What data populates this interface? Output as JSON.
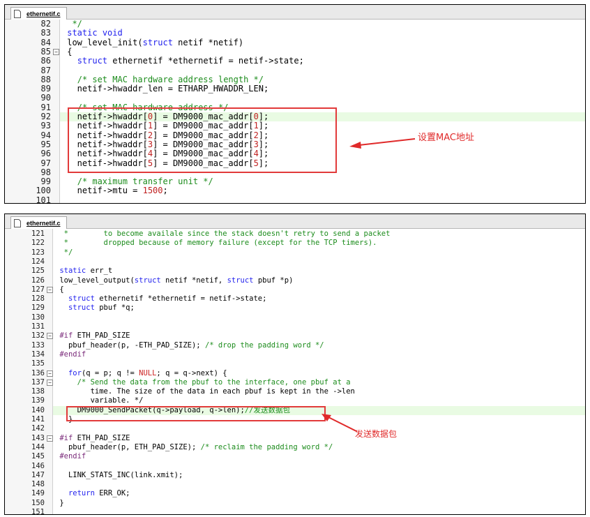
{
  "colors": {
    "keyword": "#2222ee",
    "comment": "#1c8c1c",
    "number": "#c02020",
    "annotation": "#e02a2a",
    "highlight": "#e9fbe3"
  },
  "panel1": {
    "tab": {
      "label": "ethernetif.c",
      "icon": "file-icon"
    },
    "lines": [
      {
        "n": "82",
        "text": "  */"
      },
      {
        "n": "83",
        "text": " static void"
      },
      {
        "n": "84",
        "text": " low_level_init(struct netif *netif)"
      },
      {
        "n": "85",
        "text": " {"
      },
      {
        "n": "86",
        "text": "   struct ethernetif *ethernetif = netif->state;"
      },
      {
        "n": "87",
        "text": ""
      },
      {
        "n": "88",
        "text": "   /* set MAC hardware address length */"
      },
      {
        "n": "89",
        "text": "   netif->hwaddr_len = ETHARP_HWADDR_LEN;"
      },
      {
        "n": "90",
        "text": ""
      },
      {
        "n": "91",
        "text": "   /* set MAC hardware address */"
      },
      {
        "n": "92",
        "text": "   netif->hwaddr[0] = DM9000_mac_addr[0];"
      },
      {
        "n": "93",
        "text": "   netif->hwaddr[1] = DM9000_mac_addr[1];"
      },
      {
        "n": "94",
        "text": "   netif->hwaddr[2] = DM9000_mac_addr[2];"
      },
      {
        "n": "95",
        "text": "   netif->hwaddr[3] = DM9000_mac_addr[3];"
      },
      {
        "n": "96",
        "text": "   netif->hwaddr[4] = DM9000_mac_addr[4];"
      },
      {
        "n": "97",
        "text": "   netif->hwaddr[5] = DM9000_mac_addr[5];"
      },
      {
        "n": "98",
        "text": ""
      },
      {
        "n": "99",
        "text": "   /* maximum transfer unit */"
      },
      {
        "n": "100",
        "text": "   netif->mtu = 1500;"
      },
      {
        "n": "101",
        "text": ""
      }
    ],
    "annotation": "设置MAC地址"
  },
  "panel2": {
    "tab": {
      "label": "ethernetif.c",
      "icon": "file-icon"
    },
    "lines": [
      {
        "n": "121",
        "text": "  *        to become availale since the stack doesn't retry to send a packet"
      },
      {
        "n": "122",
        "text": "  *        dropped because of memory failure (except for the TCP timers)."
      },
      {
        "n": "123",
        "text": "  */"
      },
      {
        "n": "124",
        "text": ""
      },
      {
        "n": "125",
        "text": " static err_t"
      },
      {
        "n": "126",
        "text": " low_level_output(struct netif *netif, struct pbuf *p)"
      },
      {
        "n": "127",
        "text": " {"
      },
      {
        "n": "128",
        "text": "   struct ethernetif *ethernetif = netif->state;"
      },
      {
        "n": "129",
        "text": "   struct pbuf *q;"
      },
      {
        "n": "130",
        "text": ""
      },
      {
        "n": "131",
        "text": ""
      },
      {
        "n": "132",
        "text": " #if ETH_PAD_SIZE"
      },
      {
        "n": "133",
        "text": "   pbuf_header(p, -ETH_PAD_SIZE); /* drop the padding word */"
      },
      {
        "n": "134",
        "text": " #endif"
      },
      {
        "n": "135",
        "text": ""
      },
      {
        "n": "136",
        "text": "   for(q = p; q != NULL; q = q->next) {"
      },
      {
        "n": "137",
        "text": "     /* Send the data from the pbuf to the interface, one pbuf at a"
      },
      {
        "n": "138",
        "text": "        time. The size of the data in each pbuf is kept in the ->len"
      },
      {
        "n": "139",
        "text": "        variable. */"
      },
      {
        "n": "140",
        "text": "     DM9000_SendPacket(q->payload, q->len);//发送数据包"
      },
      {
        "n": "141",
        "text": "   }"
      },
      {
        "n": "142",
        "text": ""
      },
      {
        "n": "143",
        "text": " #if ETH_PAD_SIZE"
      },
      {
        "n": "144",
        "text": "   pbuf_header(p, ETH_PAD_SIZE); /* reclaim the padding word */"
      },
      {
        "n": "145",
        "text": " #endif"
      },
      {
        "n": "146",
        "text": ""
      },
      {
        "n": "147",
        "text": "   LINK_STATS_INC(link.xmit);"
      },
      {
        "n": "148",
        "text": ""
      },
      {
        "n": "149",
        "text": "   return ERR_OK;"
      },
      {
        "n": "150",
        "text": " }"
      },
      {
        "n": "151",
        "text": ""
      }
    ],
    "annotation": "发送数据包"
  }
}
